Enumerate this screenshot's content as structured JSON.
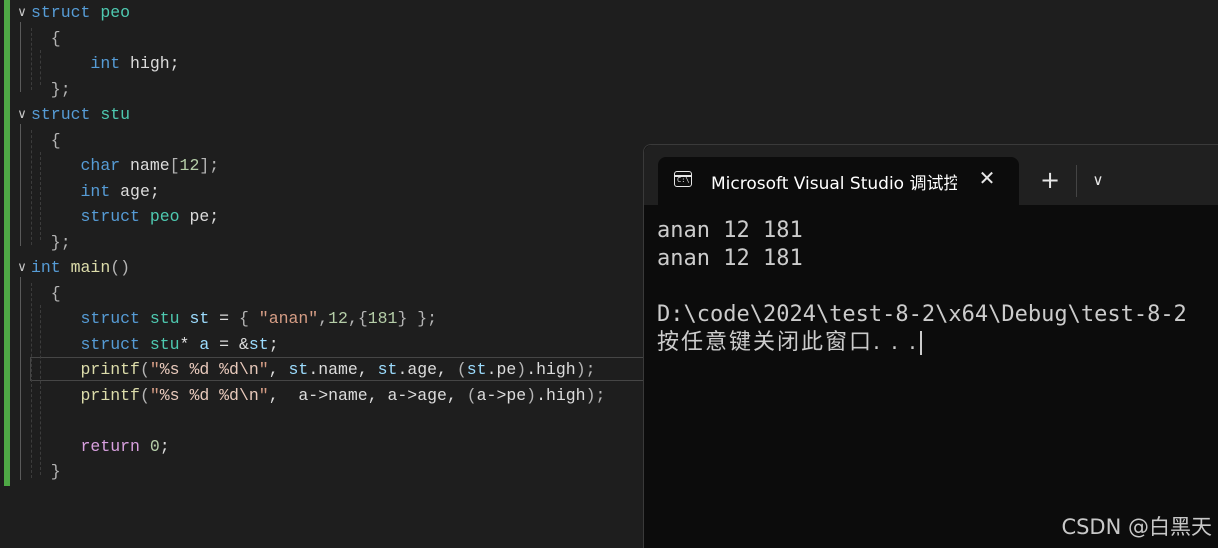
{
  "editor": {
    "lines": [
      {
        "fold": "∨",
        "parts": [
          {
            "c": "kw",
            "t": "struct "
          },
          {
            "c": "ty",
            "t": "peo"
          }
        ]
      },
      {
        "fold": "",
        "parts": [
          {
            "c": "pn",
            "t": "  {"
          }
        ]
      },
      {
        "fold": "",
        "parts": [
          {
            "c": "",
            "t": "      "
          },
          {
            "c": "kw",
            "t": "int"
          },
          {
            "c": "",
            "t": " high;"
          }
        ]
      },
      {
        "fold": "",
        "parts": [
          {
            "c": "pn",
            "t": "  };"
          }
        ]
      },
      {
        "fold": "∨",
        "parts": [
          {
            "c": "kw",
            "t": "struct "
          },
          {
            "c": "ty",
            "t": "stu"
          }
        ]
      },
      {
        "fold": "",
        "parts": [
          {
            "c": "pn",
            "t": "  {"
          }
        ]
      },
      {
        "fold": "",
        "parts": [
          {
            "c": "",
            "t": "     "
          },
          {
            "c": "kw",
            "t": "char"
          },
          {
            "c": "",
            "t": " name"
          },
          {
            "c": "pn",
            "t": "["
          },
          {
            "c": "num",
            "t": "12"
          },
          {
            "c": "pn",
            "t": "];"
          }
        ]
      },
      {
        "fold": "",
        "parts": [
          {
            "c": "",
            "t": "     "
          },
          {
            "c": "kw",
            "t": "int"
          },
          {
            "c": "",
            "t": " age;"
          }
        ]
      },
      {
        "fold": "",
        "parts": [
          {
            "c": "",
            "t": "     "
          },
          {
            "c": "kw",
            "t": "struct "
          },
          {
            "c": "ty",
            "t": "peo"
          },
          {
            "c": "",
            "t": " pe;"
          }
        ]
      },
      {
        "fold": "",
        "parts": [
          {
            "c": "pn",
            "t": "  };"
          }
        ]
      },
      {
        "fold": "∨",
        "parts": [
          {
            "c": "kw",
            "t": "int "
          },
          {
            "c": "fn",
            "t": "main"
          },
          {
            "c": "pn",
            "t": "()"
          }
        ]
      },
      {
        "fold": "",
        "parts": [
          {
            "c": "pn",
            "t": "  {"
          }
        ]
      },
      {
        "fold": "",
        "parts": [
          {
            "c": "",
            "t": "     "
          },
          {
            "c": "kw",
            "t": "struct "
          },
          {
            "c": "ty",
            "t": "stu"
          },
          {
            "c": "",
            "t": " "
          },
          {
            "c": "var",
            "t": "st"
          },
          {
            "c": "",
            "t": " = "
          },
          {
            "c": "pn",
            "t": "{ "
          },
          {
            "c": "str",
            "t": "\"anan\""
          },
          {
            "c": "pn",
            "t": ","
          },
          {
            "c": "num",
            "t": "12"
          },
          {
            "c": "pn",
            "t": ",{"
          },
          {
            "c": "num",
            "t": "181"
          },
          {
            "c": "pn",
            "t": "} };"
          }
        ]
      },
      {
        "fold": "",
        "parts": [
          {
            "c": "",
            "t": "     "
          },
          {
            "c": "kw",
            "t": "struct "
          },
          {
            "c": "ty",
            "t": "stu"
          },
          {
            "c": "",
            "t": "* "
          },
          {
            "c": "var",
            "t": "a"
          },
          {
            "c": "",
            "t": " = &"
          },
          {
            "c": "var",
            "t": "st"
          },
          {
            "c": "",
            "t": ";"
          }
        ]
      },
      {
        "fold": "",
        "parts": [
          {
            "c": "",
            "t": "     "
          },
          {
            "c": "fn",
            "t": "printf"
          },
          {
            "c": "pn",
            "t": "("
          },
          {
            "c": "str",
            "t": "\""
          },
          {
            "c": "fmt",
            "t": "%s %d %d\\n"
          },
          {
            "c": "str",
            "t": "\""
          },
          {
            "c": "",
            "t": ", "
          },
          {
            "c": "var",
            "t": "st"
          },
          {
            "c": "",
            "t": ".name, "
          },
          {
            "c": "var",
            "t": "st"
          },
          {
            "c": "",
            "t": ".age, "
          },
          {
            "c": "pn",
            "t": "("
          },
          {
            "c": "var",
            "t": "st"
          },
          {
            "c": "",
            "t": ".pe"
          },
          {
            "c": "pn",
            "t": ")"
          },
          {
            "c": "",
            "t": ".high"
          },
          {
            "c": "pn",
            "t": ");"
          }
        ]
      },
      {
        "fold": "",
        "parts": [
          {
            "c": "",
            "t": "     "
          },
          {
            "c": "fn",
            "t": "printf"
          },
          {
            "c": "pn",
            "t": "("
          },
          {
            "c": "str",
            "t": "\""
          },
          {
            "c": "fmt",
            "t": "%s %d %d\\n"
          },
          {
            "c": "str",
            "t": "\""
          },
          {
            "c": "",
            "t": ",  a->name, a->age, "
          },
          {
            "c": "pn",
            "t": "("
          },
          {
            "c": "",
            "t": "a->pe"
          },
          {
            "c": "pn",
            "t": ")"
          },
          {
            "c": "",
            "t": ".high"
          },
          {
            "c": "pn",
            "t": ");"
          }
        ]
      },
      {
        "fold": "",
        "parts": [
          {
            "c": "",
            "t": ""
          }
        ]
      },
      {
        "fold": "",
        "parts": [
          {
            "c": "",
            "t": "     "
          },
          {
            "c": "ret",
            "t": "return"
          },
          {
            "c": "",
            "t": " "
          },
          {
            "c": "num",
            "t": "0"
          },
          {
            "c": "",
            "t": ";"
          }
        ]
      },
      {
        "fold": "",
        "parts": [
          {
            "c": "pn",
            "t": "  }"
          }
        ]
      }
    ]
  },
  "terminal": {
    "tab_title": "Microsoft Visual Studio 调试控制台",
    "icon": "terminal-icon",
    "close_symbol": "✕",
    "new_tab_symbol": "+",
    "dropdown_symbol": "∨",
    "output": [
      "anan 12 181",
      "anan 12 181",
      "",
      "D:\\code\\2024\\test-8-2\\x64\\Debug\\test-8-2",
      "按任意键关闭此窗口. . ."
    ]
  },
  "watermark": "CSDN @白黑天"
}
